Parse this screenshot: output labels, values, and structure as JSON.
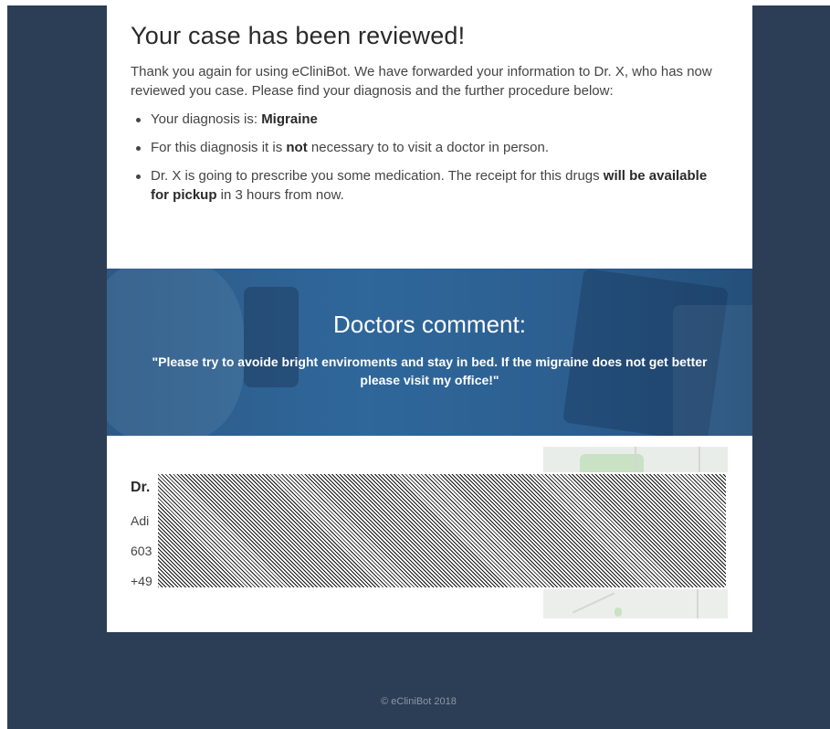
{
  "email": {
    "headline": "Your case has been reviewed!",
    "intro": "Thank you again for using eCliniBot. We have forwarded your information to Dr. X, who has now reviewed you case. Please find your diagnosis and the further procedure below:",
    "bullets": [
      {
        "pre": "Your diagnosis is: ",
        "bold": "Migraine",
        "post": ""
      },
      {
        "pre": "For this diagnosis it is ",
        "bold": "not",
        "post": " necessary to to visit a doctor in person."
      },
      {
        "pre": "Dr. X is going to prescribe you some medication. The receipt for this drugs ",
        "bold": "will be available for pickup",
        "post": " in 3 hours from now."
      }
    ],
    "banner": {
      "title": "Doctors comment:",
      "quote": "\"Please try to avoide bright enviroments and stay in bed. If the migraine does not get better please visit my office!\""
    },
    "contact": {
      "name": "Dr.",
      "line1": "Adi",
      "line2": "603",
      "line3": "+49"
    },
    "footer": "© eCliniBot 2018"
  },
  "colors": {
    "frame": "#2c3e55",
    "banner": "#2f679b",
    "card": "#ffffff"
  }
}
